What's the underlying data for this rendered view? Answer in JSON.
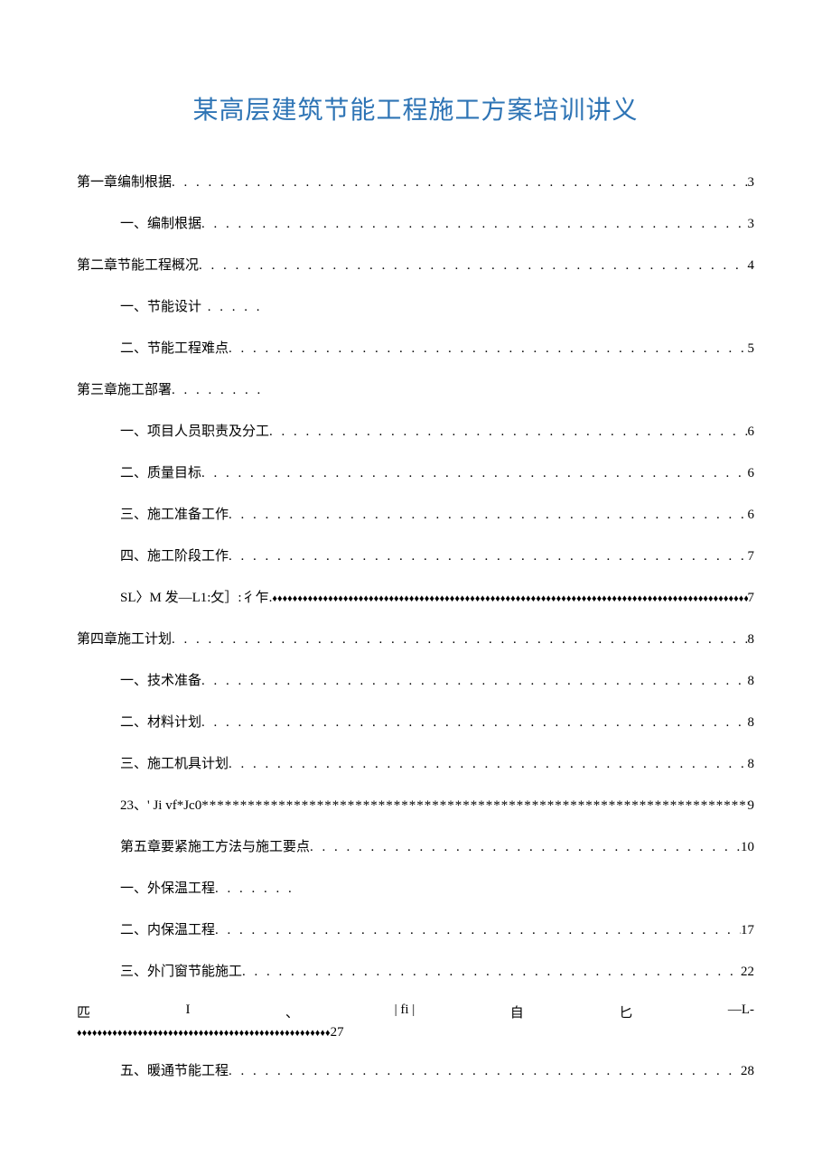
{
  "title": "某高层建筑节能工程施工方案培训讲义",
  "toc": {
    "line1": {
      "text": "第一章编制根据",
      "page": "3"
    },
    "line2": {
      "text": "一、编制根据",
      "page": "3"
    },
    "line3": {
      "text": "第二章节能工程概况",
      "page": "4"
    },
    "line4": {
      "text": "一、节能设计",
      "dots": " . . . . ."
    },
    "line5": {
      "text": "二、节能工程难点",
      "page": "5"
    },
    "line6": {
      "text": "第三章施工部署",
      "dots": ". . . . . . . ."
    },
    "line7": {
      "text": "一、项目人员职责及分工",
      "page": "6"
    },
    "line8": {
      "text": "二、质量目标",
      "page": "6"
    },
    "line9": {
      "text": "三、施工准备工作",
      "page": "6"
    },
    "line10": {
      "text": "四、施工阶段工作",
      "page": "7"
    },
    "line11": {
      "text": "SL〉M 发—L1:攵］:彳乍.",
      "page": "7"
    },
    "line12": {
      "text": "第四章施工计划",
      "page": "8"
    },
    "line13": {
      "text": "一、技术准备",
      "page": "8"
    },
    "line14": {
      "text": "二、材料计划",
      "page": "8"
    },
    "line15": {
      "text": "三、施工机具计划",
      "page": "8"
    },
    "line16": {
      "text": "23、' Ji vf*Jc0",
      "page": "9"
    },
    "line17": {
      "text": "第五章要紧施工方法与施工要点",
      "page": "10"
    },
    "line18": {
      "text": "一、外保温工程",
      "dots": ". . . . . . ."
    },
    "line19": {
      "text": "二、内保温工程",
      "page": "17"
    },
    "line20": {
      "text": "三、外门窗节能施工",
      "page": "22"
    },
    "line21": {
      "parts": [
        "匹",
        "I",
        "、",
        "| fi |",
        "自",
        "匕",
        "—L-"
      ],
      "page": "27"
    },
    "line22": {
      "text": "五、暖通节能工程",
      "page": "28"
    }
  },
  "leaders": {
    "dots": ". . . . . . . . . . . . . . . . . . . . . . . . . . . . . . . . . . . . . . . . . . . . . . . . . . . . . . . . . . . . . . . . . . . . . . . . . . . . . . . . . . . . . . . . . .",
    "diamonds": "♦♦♦♦♦♦♦♦♦♦♦♦♦♦♦♦♦♦♦♦♦♦♦♦♦♦♦♦♦♦♦♦♦♦♦♦♦♦♦♦♦♦♦♦♦♦♦♦♦♦♦♦♦♦♦♦♦♦♦♦♦♦♦♦♦♦♦♦♦♦♦♦♦♦♦♦♦♦♦♦♦♦♦♦♦♦♦♦♦♦♦♦♦♦♦♦♦♦♦♦♦♦♦♦♦♦♦♦♦♦♦♦♦♦♦♦♦♦♦♦♦♦♦♦♦♦♦♦♦♦",
    "asterisks": "**************************************************************************************************"
  }
}
